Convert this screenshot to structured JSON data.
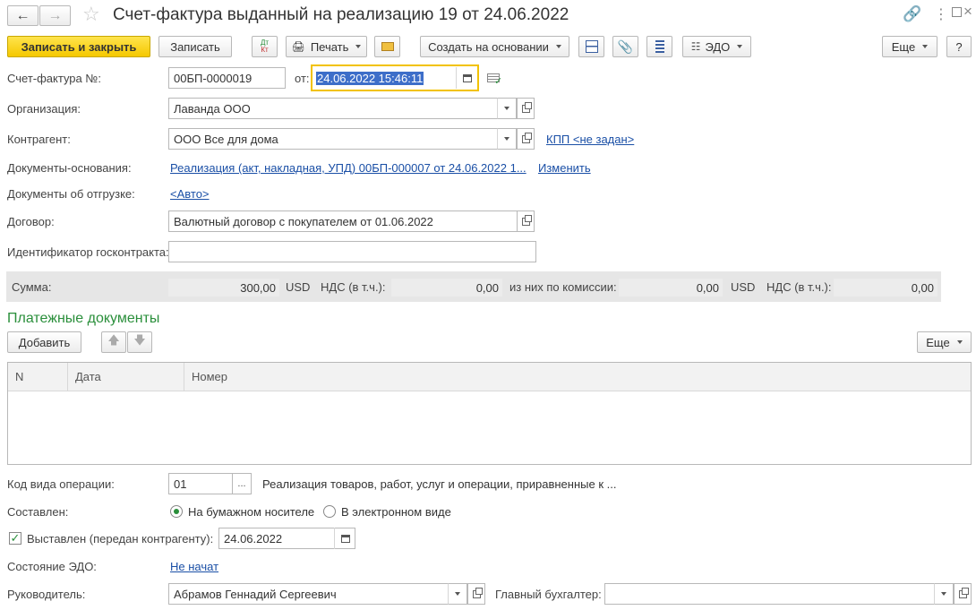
{
  "header": {
    "title": "Счет-фактура выданный на реализацию 19 от 24.06.2022"
  },
  "toolbar": {
    "save_close": "Записать и закрыть",
    "save": "Записать",
    "print": "Печать",
    "create_based": "Создать на основании",
    "edo": "ЭДО",
    "more": "Еще",
    "help": "?",
    "dt_kt": "Дт Кт"
  },
  "form": {
    "invoice_label": "Счет-фактура №:",
    "invoice_number": "00БП-0000019",
    "from_label": "от:",
    "date": "24.06.2022 15:46:11",
    "org_label": "Организация:",
    "org_value": "Лаванда ООО",
    "contractor_label": "Контрагент:",
    "contractor_value": "ООО Все для дома",
    "kpp_link": "КПП <не задан>",
    "base_docs_label": "Документы-основания:",
    "base_docs_link": "Реализация (акт, накладная, УПД) 00БП-000007 от 24.06.2022 1...",
    "change_link": "Изменить",
    "shipping_docs_label": "Документы об отгрузке:",
    "shipping_docs_link": "<Авто>",
    "contract_label": "Договор:",
    "contract_value": "Валютный договор с покупателем от 01.06.2022",
    "gov_id_label": "Идентификатор госконтракта:",
    "gov_id_value": ""
  },
  "sums": {
    "sum_label": "Сумма:",
    "sum_value": "300,00",
    "currency1": "USD",
    "vat_label1": "НДС (в т.ч.):",
    "vat_value1": "0,00",
    "commission_label": "из них по комиссии:",
    "commission_value": "0,00",
    "currency2": "USD",
    "vat_label2": "НДС (в т.ч.):",
    "vat_value2": "0,00"
  },
  "payments": {
    "title": "Платежные документы",
    "add_button": "Добавить",
    "more": "Еще",
    "columns": [
      "N",
      "Дата",
      "Номер"
    ]
  },
  "footer": {
    "op_code_label": "Код вида операции:",
    "op_code_value": "01",
    "op_code_desc": "Реализация товаров, работ, услуг и операции, приравненные к ...",
    "composed_label": "Составлен:",
    "paper_option": "На бумажном носителе",
    "electronic_option": "В электронном виде",
    "issued_label": "Выставлен (передан контрагенту):",
    "issued_date": "24.06.2022",
    "edo_state_label": "Состояние ЭДО:",
    "edo_state_link": "Не начат",
    "head_label": "Руководитель:",
    "head_value": "Абрамов Геннадий Сергеевич",
    "accountant_label": "Главный бухгалтер:",
    "accountant_value": ""
  }
}
